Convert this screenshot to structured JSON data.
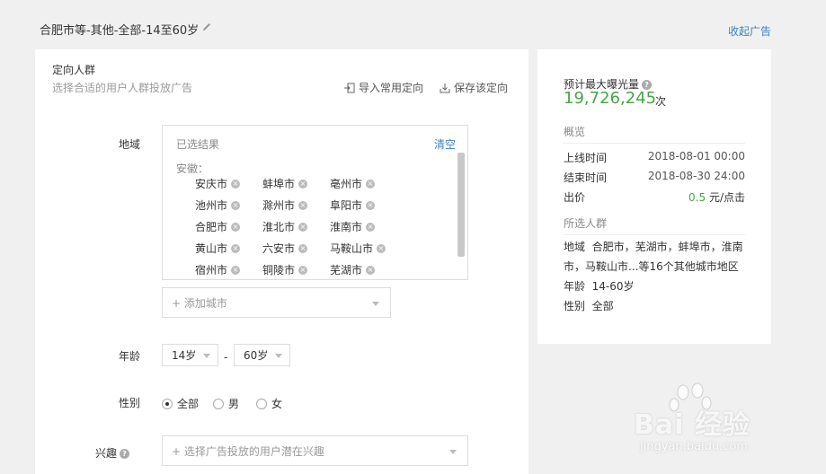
{
  "header": {
    "ad_title": "合肥市等-其他-全部-14至60岁",
    "collapse_label": "收起广告"
  },
  "targeting": {
    "title": "定向人群",
    "subtitle": "选择合适的用户人群投放广告",
    "import_label": "导入常用定向",
    "save_label": "保存该定向",
    "region": {
      "label": "地域",
      "selected_header": "已选结果",
      "clear_label": "清空",
      "province": "安徽：",
      "cities": [
        "安庆市",
        "蚌埠市",
        "亳州市",
        "池州市",
        "滁州市",
        "阜阳市",
        "合肥市",
        "淮北市",
        "淮南市",
        "黄山市",
        "六安市",
        "马鞍山市",
        "宿州市",
        "铜陵市",
        "芜湖市"
      ],
      "add_city_placeholder": "+ 添加城市"
    },
    "age": {
      "label": "年龄",
      "from": "14岁",
      "separator": "-",
      "to": "60岁"
    },
    "gender": {
      "label": "性别",
      "options": [
        "全部",
        "男",
        "女"
      ],
      "selected": "全部"
    },
    "interest": {
      "label": "兴趣",
      "placeholder": "+ 选择广告投放的用户潜在兴趣"
    }
  },
  "summary": {
    "exposure_label": "预计最大曝光量",
    "exposure_value": "19,726,245",
    "exposure_unit": "次",
    "overview_title": "概览",
    "rows": [
      {
        "label": "上线时间",
        "value": "2018-08-01 00:00"
      },
      {
        "label": "结束时间",
        "value": "2018-08-30 24:00"
      }
    ],
    "bid_label": "出价",
    "bid_value": "0.5",
    "bid_unit": "元/点击",
    "audience_title": "所选人群",
    "audience_region_label": "地域",
    "audience_region_value": "合肥市，芜湖市，蚌埠市，淮南市，马鞍山市...等16个其他城市地区",
    "audience_age_label": "年龄",
    "audience_age_value": "14-60岁",
    "audience_gender_label": "性别",
    "audience_gender_value": "全部"
  },
  "watermark": {
    "text": "Bai 经验",
    "url": "jingyan.baidu.com"
  },
  "colors": {
    "accent": "#3b82c4",
    "green": "#47a447"
  }
}
